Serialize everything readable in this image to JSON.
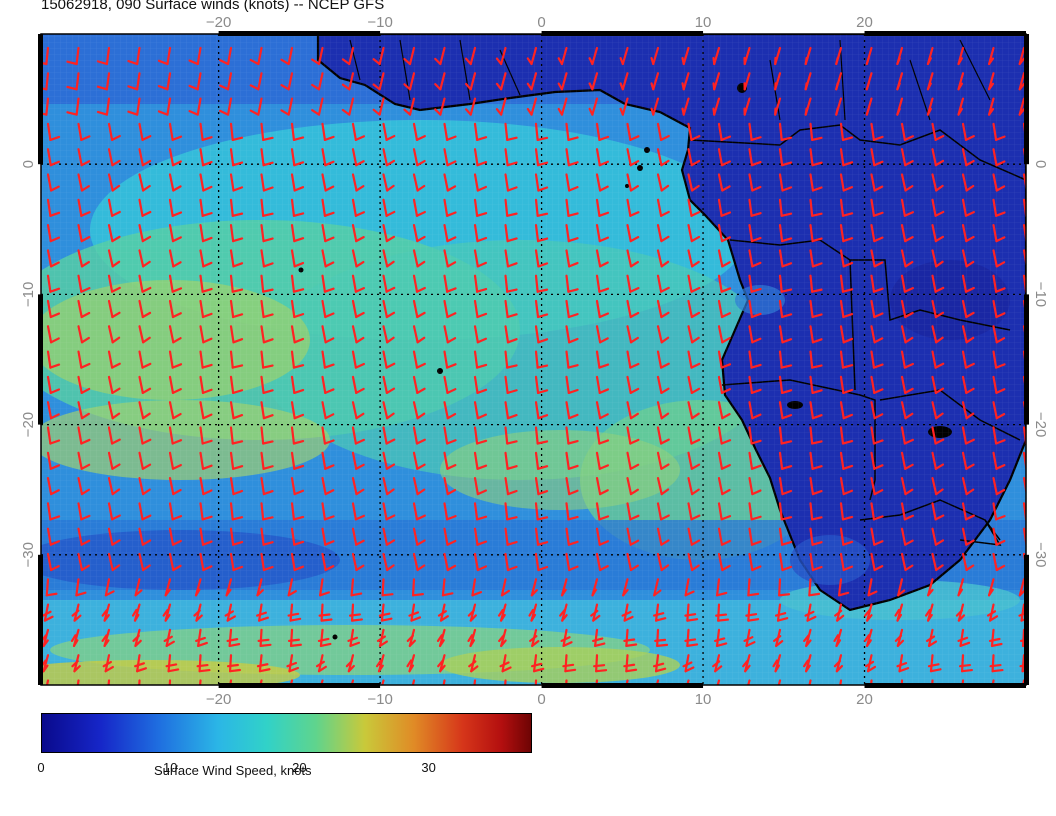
{
  "title": "15062918, 090 Surface winds (knots) -- NCEP GFS",
  "map": {
    "lon_range": [
      -31,
      30
    ],
    "lat_range": [
      -40,
      10
    ],
    "lon_ticks": [
      {
        "value": -20,
        "label": "−20"
      },
      {
        "value": -10,
        "label": "−10"
      },
      {
        "value": 0,
        "label": "0"
      },
      {
        "value": 10,
        "label": "10"
      },
      {
        "value": 20,
        "label": "20"
      }
    ],
    "lat_ticks": [
      {
        "value": 0,
        "label": "0"
      },
      {
        "value": -10,
        "label": "−10"
      },
      {
        "value": -20,
        "label": "−20"
      },
      {
        "value": -30,
        "label": "−30"
      }
    ],
    "barb_color": "#ff2222",
    "land_outline_color": "#000000"
  },
  "colorbar": {
    "label": "Surface Wind Speed, knots",
    "range": [
      0,
      38
    ],
    "ticks": [
      {
        "value": 0,
        "label": "0"
      },
      {
        "value": 10,
        "label": "10"
      },
      {
        "value": 20,
        "label": "20"
      },
      {
        "value": 30,
        "label": "30"
      }
    ]
  }
}
